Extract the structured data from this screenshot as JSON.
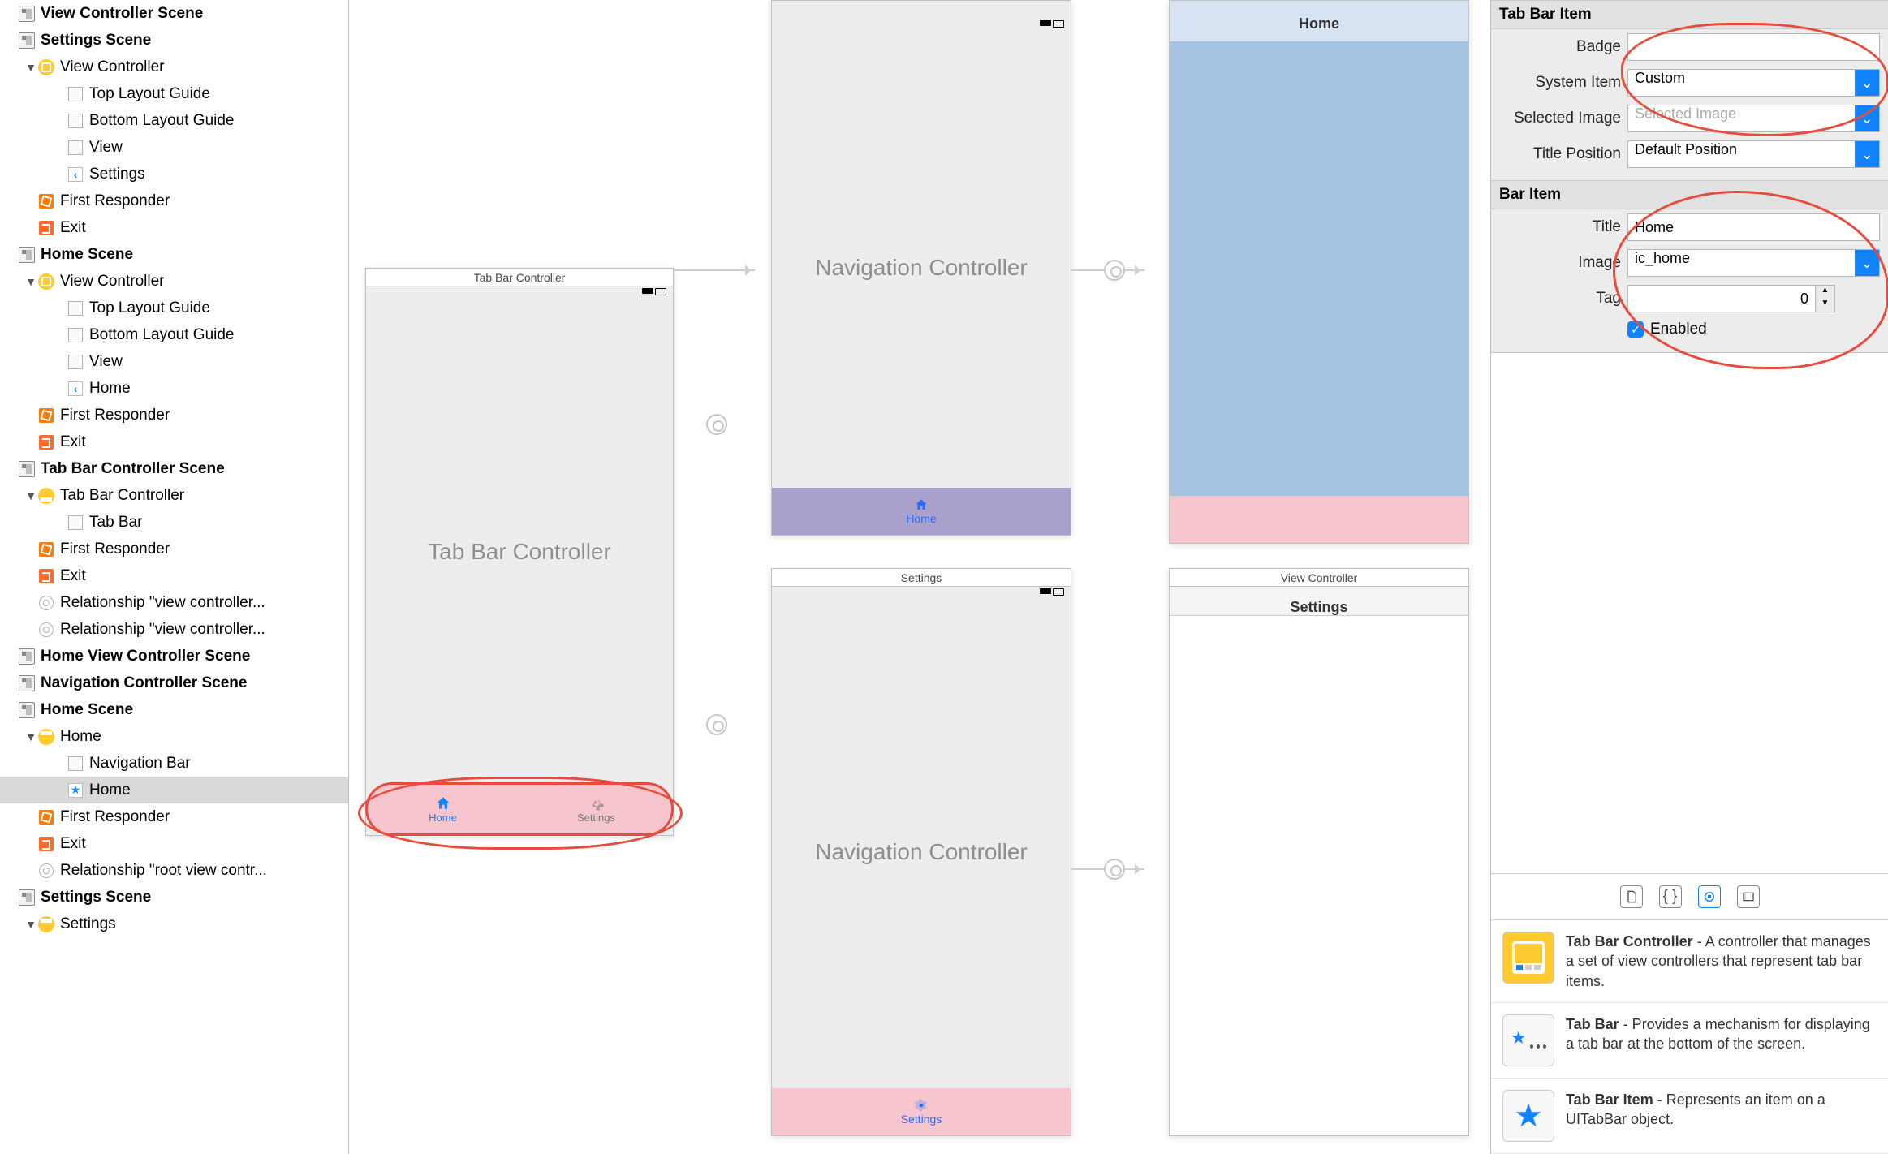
{
  "outline": [
    {
      "kind": "scene",
      "label": "View Controller Scene",
      "indent": 0,
      "icon": "scene",
      "bold": true
    },
    {
      "kind": "scene",
      "label": "Settings Scene",
      "indent": 0,
      "icon": "scene",
      "bold": true
    },
    {
      "kind": "group",
      "label": "View Controller",
      "indent": 1,
      "icon": "vc",
      "disc": "▼"
    },
    {
      "kind": "item",
      "label": "Top Layout Guide",
      "indent": 2,
      "icon": "box"
    },
    {
      "kind": "item",
      "label": "Bottom Layout Guide",
      "indent": 2,
      "icon": "box"
    },
    {
      "kind": "item",
      "label": "View",
      "indent": 2,
      "icon": "box"
    },
    {
      "kind": "item",
      "label": "Settings",
      "indent": 2,
      "icon": "back"
    },
    {
      "kind": "item",
      "label": "First Responder",
      "indent": 1,
      "icon": "cube"
    },
    {
      "kind": "item",
      "label": "Exit",
      "indent": 1,
      "icon": "exit"
    },
    {
      "kind": "scene",
      "label": "Home Scene",
      "indent": 0,
      "icon": "scene",
      "bold": true
    },
    {
      "kind": "group",
      "label": "View Controller",
      "indent": 1,
      "icon": "vc",
      "disc": "▼"
    },
    {
      "kind": "item",
      "label": "Top Layout Guide",
      "indent": 2,
      "icon": "box"
    },
    {
      "kind": "item",
      "label": "Bottom Layout Guide",
      "indent": 2,
      "icon": "box"
    },
    {
      "kind": "item",
      "label": "View",
      "indent": 2,
      "icon": "box"
    },
    {
      "kind": "item",
      "label": "Home",
      "indent": 2,
      "icon": "back"
    },
    {
      "kind": "item",
      "label": "First Responder",
      "indent": 1,
      "icon": "cube"
    },
    {
      "kind": "item",
      "label": "Exit",
      "indent": 1,
      "icon": "exit"
    },
    {
      "kind": "scene",
      "label": "Tab Bar Controller Scene",
      "indent": 0,
      "icon": "scene",
      "bold": true
    },
    {
      "kind": "group",
      "label": "Tab Bar Controller",
      "indent": 1,
      "icon": "tbc",
      "disc": "▼"
    },
    {
      "kind": "item",
      "label": "Tab Bar",
      "indent": 2,
      "icon": "box"
    },
    {
      "kind": "item",
      "label": "First Responder",
      "indent": 1,
      "icon": "cube"
    },
    {
      "kind": "item",
      "label": "Exit",
      "indent": 1,
      "icon": "exit"
    },
    {
      "kind": "item",
      "label": "Relationship \"view controller...",
      "indent": 1,
      "icon": "rel"
    },
    {
      "kind": "item",
      "label": "Relationship \"view controller...",
      "indent": 1,
      "icon": "rel"
    },
    {
      "kind": "scene",
      "label": "Home View Controller Scene",
      "indent": 0,
      "icon": "scene",
      "bold": true
    },
    {
      "kind": "scene",
      "label": "Navigation Controller Scene",
      "indent": 0,
      "icon": "scene",
      "bold": true
    },
    {
      "kind": "scene",
      "label": "Home Scene",
      "indent": 0,
      "icon": "scene",
      "bold": true
    },
    {
      "kind": "group",
      "label": "Home",
      "indent": 1,
      "icon": "nav",
      "disc": "▼"
    },
    {
      "kind": "item",
      "label": "Navigation Bar",
      "indent": 2,
      "icon": "box"
    },
    {
      "kind": "item",
      "label": "Home",
      "indent": 2,
      "icon": "star",
      "selected": true
    },
    {
      "kind": "item",
      "label": "First Responder",
      "indent": 1,
      "icon": "cube"
    },
    {
      "kind": "item",
      "label": "Exit",
      "indent": 1,
      "icon": "exit"
    },
    {
      "kind": "item",
      "label": "Relationship \"root view contr...",
      "indent": 1,
      "icon": "rel"
    },
    {
      "kind": "scene",
      "label": "Settings Scene",
      "indent": 0,
      "icon": "scene",
      "bold": true
    },
    {
      "kind": "group",
      "label": "Settings",
      "indent": 1,
      "icon": "nav",
      "disc": "▼"
    }
  ],
  "canvas": {
    "tabbar_controller": {
      "title": "Tab Bar Controller",
      "label": "Tab Bar Controller",
      "tabs": [
        {
          "label": "Home",
          "active": true
        },
        {
          "label": "Settings",
          "active": false
        }
      ]
    },
    "nav1": {
      "label": "Navigation Controller",
      "bottom_label": "Home"
    },
    "nav2": {
      "title": "Settings",
      "label": "Navigation Controller",
      "bottom_label": "Settings"
    },
    "home_vc": {
      "header": "Home"
    },
    "settings_vc": {
      "title": "View Controller",
      "header": "Settings"
    }
  },
  "inspector": {
    "tabbaritem": {
      "section": "Tab Bar Item",
      "badge_label": "Badge",
      "badge": "",
      "system_item_label": "System Item",
      "system_item": "Custom",
      "selected_image_label": "Selected Image",
      "selected_image_placeholder": "Selected Image",
      "title_position_label": "Title Position",
      "title_position": "Default Position"
    },
    "baritem": {
      "section": "Bar Item",
      "title_label": "Title",
      "title": "Home",
      "image_label": "Image",
      "image": "ic_home",
      "tag_label": "Tag",
      "tag": "0",
      "enabled_label": "Enabled",
      "enabled": true
    },
    "library": [
      {
        "icon": "tbc",
        "title": "Tab Bar Controller",
        "desc": " - A controller that manages a set of view controllers that represent tab bar items."
      },
      {
        "icon": "tabbar",
        "title": "Tab Bar",
        "desc": " - Provides a mechanism for displaying a tab bar at the bottom of the screen."
      },
      {
        "icon": "tabbaritem",
        "title": "Tab Bar Item",
        "desc": " - Represents an item on a UITabBar object."
      }
    ]
  }
}
